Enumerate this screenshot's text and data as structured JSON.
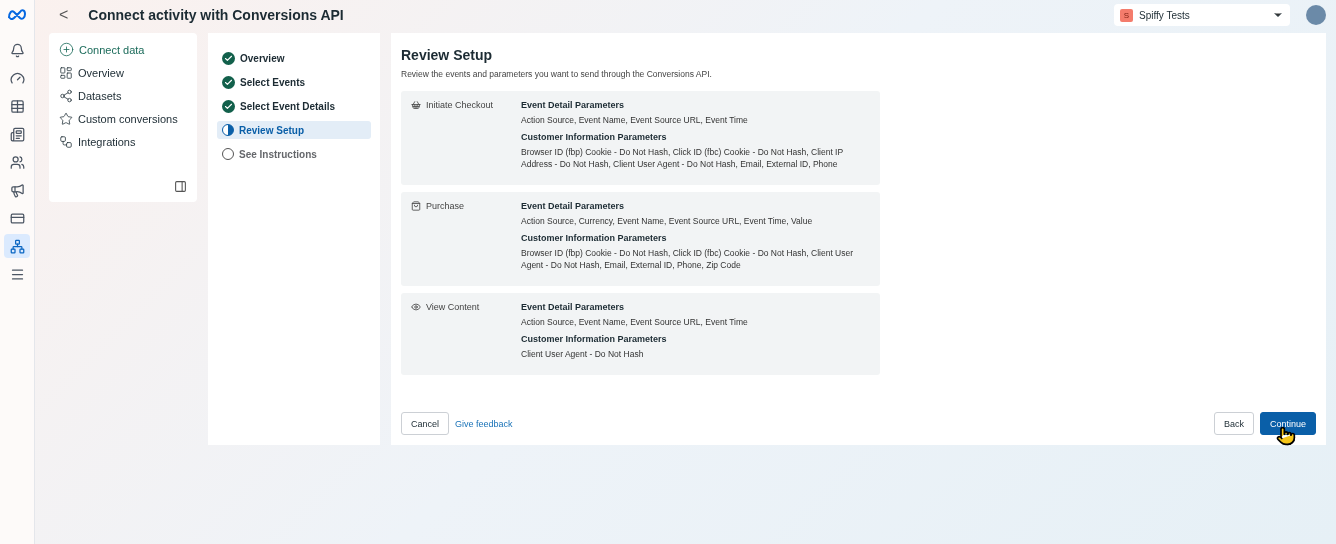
{
  "header": {
    "back": "<",
    "title": "Connect activity with Conversions API",
    "account": {
      "initial": "S",
      "name": "Spiffy Tests"
    }
  },
  "rail": [
    {
      "selected": false
    },
    {
      "selected": false
    },
    {
      "selected": false
    },
    {
      "selected": false
    },
    {
      "selected": false
    },
    {
      "selected": false
    },
    {
      "selected": false
    },
    {
      "selected": true
    },
    {
      "selected": false
    }
  ],
  "nav": [
    {
      "label": "Connect data",
      "kind": "action"
    },
    {
      "label": "Overview",
      "kind": "link"
    },
    {
      "label": "Datasets",
      "kind": "link"
    },
    {
      "label": "Custom conversions",
      "kind": "link"
    },
    {
      "label": "Integrations",
      "kind": "link"
    }
  ],
  "steps": [
    {
      "label": "Overview",
      "kind": "done",
      "selected": false
    },
    {
      "label": "Select Events",
      "kind": "done",
      "selected": false
    },
    {
      "label": "Select Event Details",
      "kind": "done",
      "selected": false
    },
    {
      "label": "Review Setup",
      "kind": "current",
      "selected": true
    },
    {
      "label": "See Instructions",
      "kind": "todo",
      "selected": false
    }
  ],
  "review": {
    "title": "Review Setup",
    "subtitle": "Review the events and parameters you want to send through the Conversions API.",
    "events": [
      {
        "name": "Initiate Checkout",
        "sections": [
          {
            "heading": "Event Detail Parameters",
            "text": "Action Source, Event Name, Event Source URL, Event Time"
          },
          {
            "heading": "Customer Information Parameters",
            "text": "Browser ID (fbp) Cookie - Do Not Hash, Click ID (fbc) Cookie - Do Not Hash, Client IP Address - Do Not Hash, Client User Agent - Do Not Hash, Email, External ID, Phone"
          }
        ]
      },
      {
        "name": "Purchase",
        "sections": [
          {
            "heading": "Event Detail Parameters",
            "text": "Action Source, Currency, Event Name, Event Source URL, Event Time, Value"
          },
          {
            "heading": "Customer Information Parameters",
            "text": "Browser ID (fbp) Cookie - Do Not Hash, Click ID (fbc) Cookie - Do Not Hash, Client User Agent - Do Not Hash, Email, External ID, Phone, Zip Code"
          }
        ]
      },
      {
        "name": "View Content",
        "sections": [
          {
            "heading": "Event Detail Parameters",
            "text": "Action Source, Event Name, Event Source URL, Event Time"
          },
          {
            "heading": "Customer Information Parameters",
            "text": "Client User Agent - Do Not Hash"
          }
        ]
      }
    ]
  },
  "footer": {
    "cancel": "Cancel",
    "feedback": "Give feedback",
    "back": "Back",
    "continue": "Continue"
  }
}
